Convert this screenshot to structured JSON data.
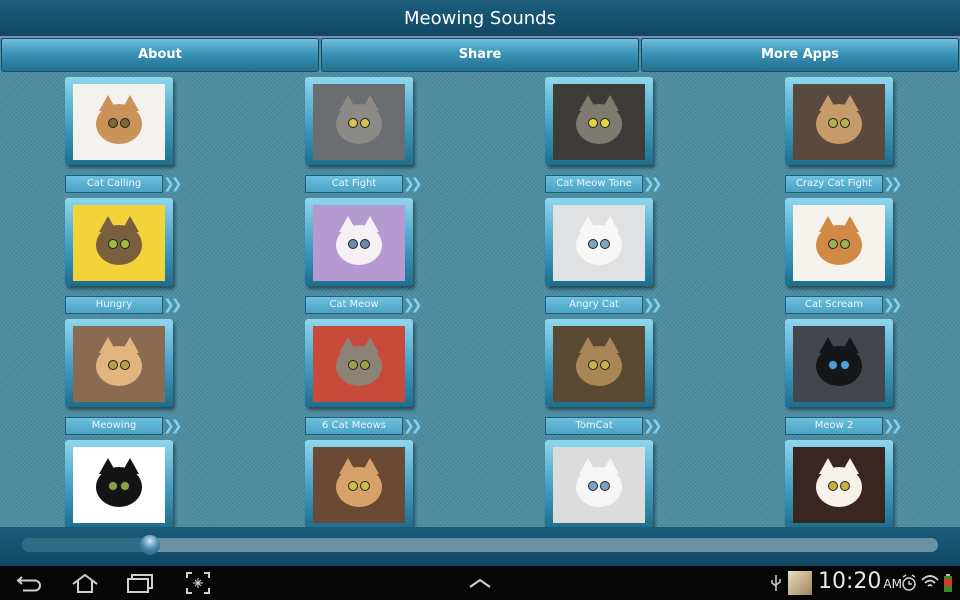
{
  "app": {
    "title": "Meowing Sounds",
    "nav": [
      {
        "label": "About"
      },
      {
        "label": "Share"
      },
      {
        "label": "More Apps"
      }
    ],
    "sounds": [
      {
        "label": "Cat Calling",
        "photo": {
          "bg": "#f4f2ee",
          "fur": "#c9935a",
          "eye": "#7a6a30"
        }
      },
      {
        "label": "Cat Fight",
        "photo": {
          "bg": "#6b6e70",
          "fur": "#8c8a86",
          "eye": "#d8c24a"
        }
      },
      {
        "label": "Cat Meow Tone",
        "photo": {
          "bg": "#3d3c38",
          "fur": "#7f7a70",
          "eye": "#e8d23a"
        }
      },
      {
        "label": "Crazy Cat Fight",
        "photo": {
          "bg": "#5a4a3e",
          "fur": "#c79a6a",
          "eye": "#b7b04a"
        }
      },
      {
        "label": "Hungry",
        "photo": {
          "bg": "#f2d43a",
          "fur": "#7a5f3e",
          "eye": "#9fbb3a"
        }
      },
      {
        "label": "Cat Meow",
        "photo": {
          "bg": "#b49ad0",
          "fur": "#f4f0f4",
          "eye": "#6a8ab0"
        }
      },
      {
        "label": "Angry Cat",
        "photo": {
          "bg": "#dfe1e3",
          "fur": "#f7f7f5",
          "eye": "#7aa6c8"
        }
      },
      {
        "label": "Cat Scream",
        "photo": {
          "bg": "#f6f3ef",
          "fur": "#d08a45",
          "eye": "#9fb05a"
        }
      },
      {
        "label": "Meowing",
        "photo": {
          "bg": "#8a6a50",
          "fur": "#e2b47e",
          "eye": "#b7a04a"
        }
      },
      {
        "label": "6 Cat Meows",
        "photo": {
          "bg": "#c84a3a",
          "fur": "#8c8276",
          "eye": "#a0a04a"
        }
      },
      {
        "label": "TomCat",
        "photo": {
          "bg": "#5a4a34",
          "fur": "#a88656",
          "eye": "#c6b24a"
        }
      },
      {
        "label": "Meow 2",
        "photo": {
          "bg": "#43464c",
          "fur": "#15161a",
          "eye": "#4aa0e0"
        }
      },
      {
        "label": "",
        "photo": {
          "bg": "#ffffff",
          "fur": "#141414",
          "eye": "#8aa04a"
        }
      },
      {
        "label": "",
        "photo": {
          "bg": "#6a4a34",
          "fur": "#d6a26a",
          "eye": "#c8c04a"
        }
      },
      {
        "label": "",
        "photo": {
          "bg": "#dcdcdc",
          "fur": "#f6f6f6",
          "eye": "#7aa0c8"
        }
      },
      {
        "label": "",
        "photo": {
          "bg": "#3a2620",
          "fur": "#f6f1ea",
          "eye": "#c8b03a"
        }
      }
    ],
    "player": {
      "progress": 0.14
    }
  },
  "system_bar": {
    "icons_left": [
      "back-icon",
      "home-icon",
      "recent-apps-icon",
      "screenshot-icon"
    ],
    "center_icon": "chevron-up-icon",
    "status_icons": [
      "usb-icon",
      "notification-thumbnail",
      "alarm-icon",
      "wifi-icon",
      "battery-icon"
    ],
    "time": "10:20",
    "ampm": "AM"
  }
}
